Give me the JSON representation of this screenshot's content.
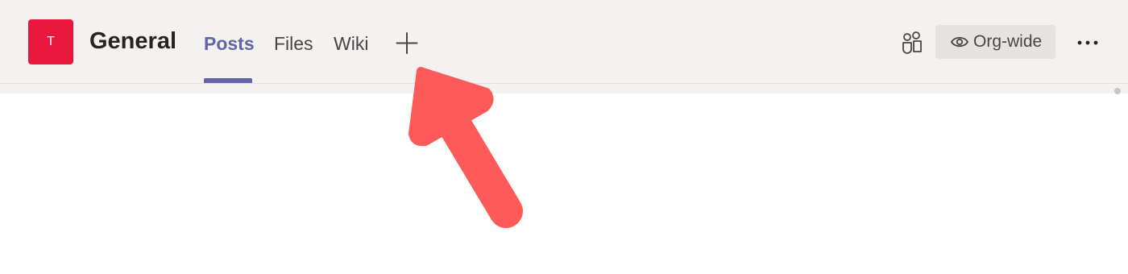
{
  "team": {
    "avatar_initial": "T",
    "avatar_color": "#e8173d"
  },
  "channel": {
    "title": "General"
  },
  "tabs": [
    {
      "label": "Posts",
      "active": true
    },
    {
      "label": "Files",
      "active": false
    },
    {
      "label": "Wiki",
      "active": false
    }
  ],
  "add_tab": {
    "icon": "plus-icon"
  },
  "toolbar": {
    "people_icon": "people-icon",
    "privacy_icon": "eye-icon",
    "privacy_label": "Org-wide",
    "more_icon": "more-options-icon"
  },
  "annotation": {
    "type": "arrow",
    "color": "#ff5a5a",
    "points_to": "add-tab-button"
  },
  "colors": {
    "accent": "#6264a7",
    "header_bg": "#f3f2f1"
  }
}
